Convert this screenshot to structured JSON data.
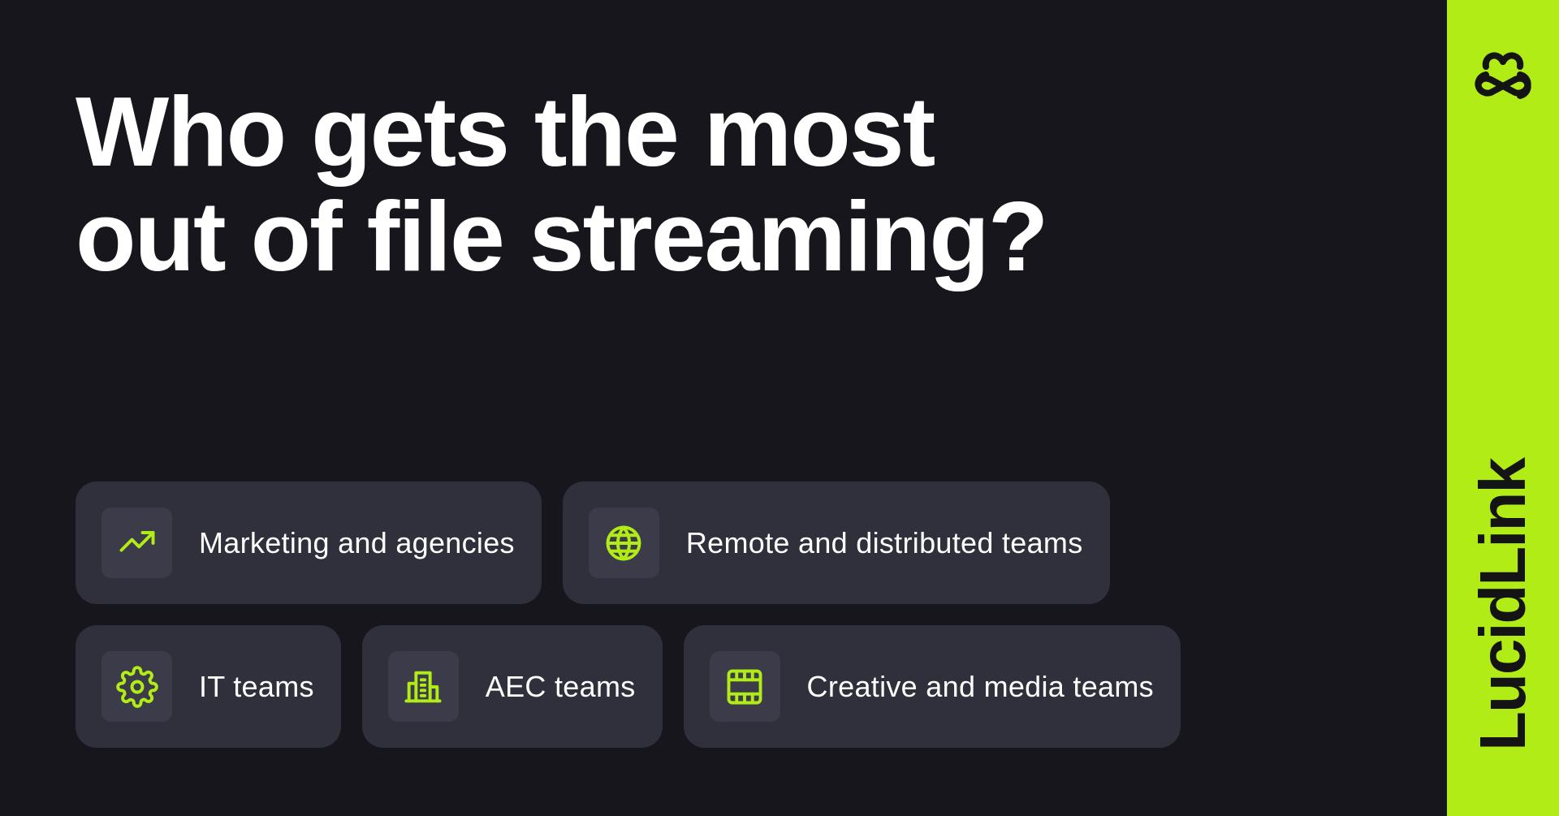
{
  "headline": {
    "line1": "Who gets the most",
    "line2": "out of file streaming?"
  },
  "cards": [
    {
      "label": "Marketing and agencies",
      "icon": "trending-up-icon"
    },
    {
      "label": "Remote and distributed teams",
      "icon": "globe-icon"
    },
    {
      "label": "IT teams",
      "icon": "gear-icon"
    },
    {
      "label": "AEC teams",
      "icon": "building-icon"
    },
    {
      "label": "Creative and media teams",
      "icon": "film-icon"
    }
  ],
  "brand": {
    "name": "LucidLink",
    "logo": "lucidlink-logo-icon"
  },
  "colors": {
    "background": "#17161d",
    "card": "#302f3c",
    "icon_box": "#3c3b4a",
    "accent": "#b2ec16",
    "text": "#ffffff"
  }
}
